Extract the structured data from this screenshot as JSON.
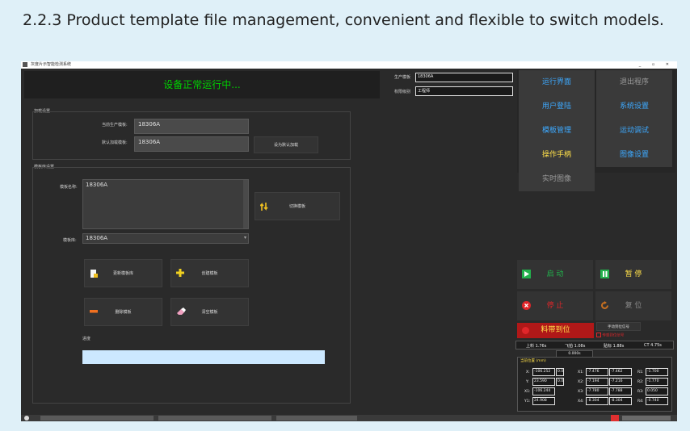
{
  "caption": "2.2.3 Product template file management, convenient and flexible to switch models.",
  "window": {
    "title": "灰度片示智能检测系统",
    "controls": "_ ▫ ✕"
  },
  "status": {
    "text": "设备正常运行中..."
  },
  "top_fields": {
    "production_model_label": "生产模板",
    "production_model_value": "18306A",
    "permission_label": "权限级别",
    "permission_value": "工程师"
  },
  "load_settings": {
    "group_title": "加载设置",
    "current_model_label": "当前生产模板:",
    "current_model_value": "18306A",
    "default_model_label": "默认加载模板:",
    "default_model_value": "18306A",
    "set_default_button": "设为默认加载"
  },
  "library_settings": {
    "group_title": "模板库设置",
    "template_name_label": "模板名称:",
    "template_name_value": "18306A",
    "switch_button": "切换模板",
    "library_label": "模板库:",
    "library_value": "18306A",
    "update_button": "更新模板库",
    "create_button": "创建模板",
    "delete_button": "删除模板",
    "clear_button": "清空模板",
    "progress_label": "进度"
  },
  "nav": {
    "run_ui": "运行界面",
    "exit": "退出程序",
    "user_login": "用户登陆",
    "system_settings": "系统设置",
    "template_mgmt": "模板管理",
    "motion_debug": "运动调试",
    "handheld": "操作手柄",
    "image_settings": "图像设置",
    "realtime_image": "实时图像"
  },
  "controls": {
    "start": "启 动",
    "pause": "暂 停",
    "stop": "停 止",
    "reset": "复 位",
    "belt_ready": "料带到位",
    "manual_signal": "手动到位信号",
    "sensor_signal": "传感到位信号"
  },
  "stats": {
    "feed": "上料 1.76s",
    "fly": "飞拍 1.08s",
    "paste": "贴标 1.88s",
    "ct": "CT 4.75s",
    "extra": "0.000s"
  },
  "position": {
    "title": "当前位置 (mm)",
    "rows": [
      {
        "label": "X:",
        "v1": "-106.252",
        "v2": "0.0",
        "label2": "X1:",
        "v3": "-7.476",
        "v4": "-7.462",
        "label3": "R1:",
        "v5": "-1.700"
      },
      {
        "label": "Y:",
        "v1": "23.590",
        "v2": "0.0",
        "label2": "X2:",
        "v3": "-7.194",
        "v4": "-7.216",
        "label3": "R2:",
        "v5": "-1.770"
      },
      {
        "label": "X1:",
        "v1": "-106.244",
        "v2": "",
        "label2": "X3:",
        "v3": "-7.780",
        "v4": "-7.788",
        "label3": "R3:",
        "v5": "0.050"
      },
      {
        "label": "Y1:",
        "v1": "24.908",
        "v2": "",
        "label2": "X4:",
        "v3": "-8.304",
        "v4": "-8.304",
        "label3": "R4:",
        "v5": "-0.740"
      }
    ]
  },
  "colors": {
    "status_green": "#00d000",
    "nav_blue": "#3da9ff",
    "handle_yellow": "#ffe04a",
    "start_green": "#22b14c",
    "stop_red": "#e0262a",
    "belt_red": "#b01818",
    "progress_fill": "#cce8ff"
  },
  "icons": {
    "update": "document-icon",
    "create": "plus-icon",
    "delete": "minus-icon",
    "clear": "eraser-icon",
    "switch": "swap-arrows-icon",
    "start": "play-icon",
    "pause": "pause-icon",
    "stop": "stop-icon",
    "reset": "refresh-icon"
  }
}
